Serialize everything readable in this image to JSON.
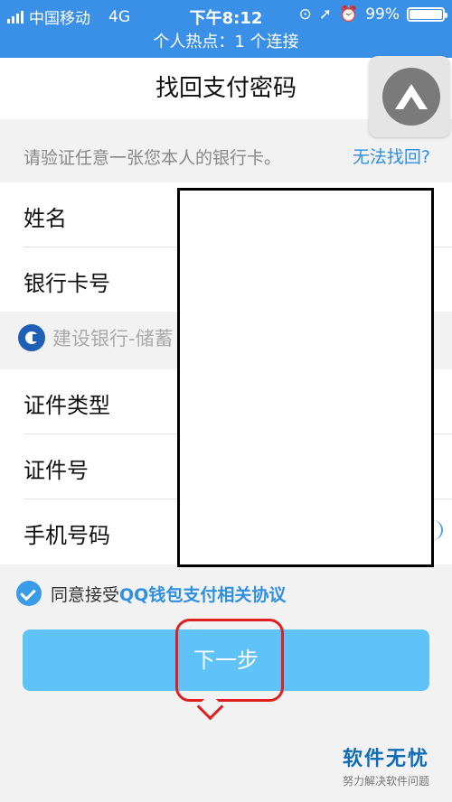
{
  "status_bar": {
    "carrier": "中国移动",
    "network": "4G",
    "time": "下午8:12",
    "battery": "99%",
    "battery_level": 0.99,
    "hotspot": "个人热点：1 个连接"
  },
  "header": {
    "title": "找回支付密码"
  },
  "hint": {
    "text": "请验证任意一张您本人的银行卡。",
    "link": "无法找回?"
  },
  "form": {
    "name_label": "姓名",
    "card_label": "银行卡号",
    "bank_name": "建设银行-储蓄",
    "id_type_label": "证件类型",
    "id_number_label": "证件号",
    "phone_label": "手机号码"
  },
  "agreement": {
    "prefix": "同意接受",
    "link": "QQ钱包支付相关协议"
  },
  "next_button": {
    "label": "下一步"
  },
  "watermark": {
    "title": "软件无忧",
    "subtitle": "努力解决软件问题"
  },
  "colors": {
    "accent": "#3a8fe6",
    "link": "#2f8fe0",
    "button": "#5fc3f8",
    "highlight": "#e02020"
  }
}
